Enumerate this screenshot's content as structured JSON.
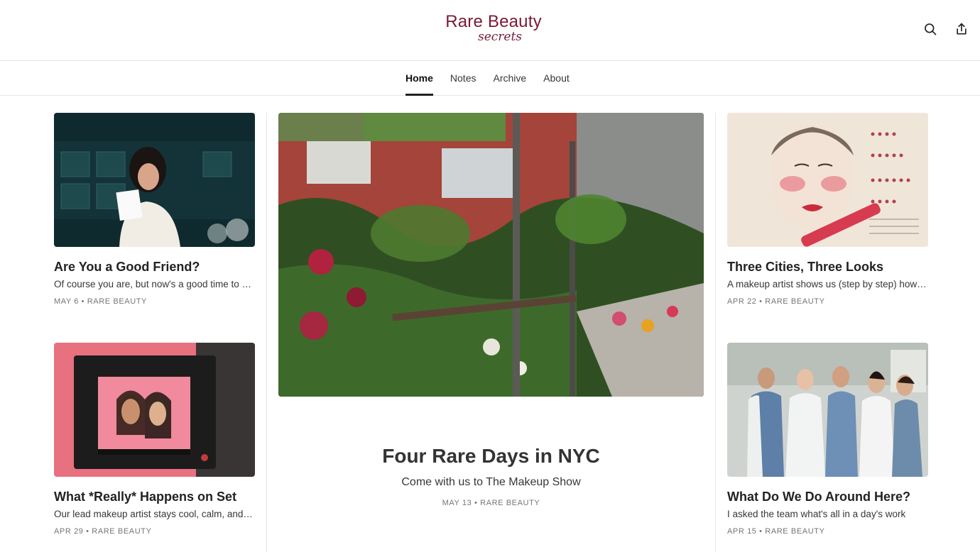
{
  "header": {
    "logo_line1": "Rare Beauty",
    "logo_line2": "secrets",
    "icons": [
      "search-icon",
      "share-icon"
    ]
  },
  "nav": {
    "tabs": [
      {
        "label": "Home",
        "active": true
      },
      {
        "label": "Notes",
        "active": false
      },
      {
        "label": "Archive",
        "active": false
      },
      {
        "label": "About",
        "active": false
      }
    ]
  },
  "posts": {
    "left_top": {
      "title": "Are You a Good Friend?",
      "subtitle": "Of course you are, but now's a good time to check in",
      "date": "MAY 6",
      "author": "RARE BEAUTY"
    },
    "left_bottom": {
      "title": "What *Really* Happens on Set",
      "subtitle": "Our lead makeup artist stays cool, calm, and collected",
      "date": "APR 29",
      "author": "RARE BEAUTY"
    },
    "featured": {
      "title": "Four Rare Days in NYC",
      "subtitle": "Come with us to The Makeup Show",
      "date": "MAY 13",
      "author": "RARE BEAUTY"
    },
    "right_top": {
      "title": "Three Cities, Three Looks",
      "subtitle": "A makeup artist shows us (step by step) how to get the look",
      "date": "APR 22",
      "author": "RARE BEAUTY"
    },
    "right_bottom": {
      "title": "What Do We Do Around Here?",
      "subtitle": "I asked the team what's all in a day's work",
      "date": "APR 15",
      "author": "RARE BEAUTY"
    }
  },
  "meta_separator": "•",
  "colors": {
    "brand": "#7a1a33",
    "text": "#363737",
    "meta": "#757575",
    "divider": "#e6e6e6"
  }
}
